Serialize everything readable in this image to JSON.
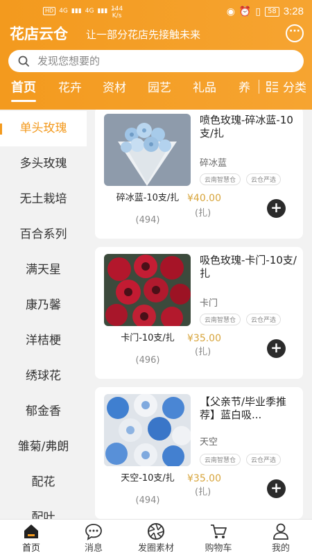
{
  "status_bar": {
    "network_left": "HD",
    "signal1": "4G",
    "signal2": "4G",
    "speed_value": "144",
    "speed_unit": "K/s",
    "battery": "58",
    "time": "3:28"
  },
  "header": {
    "app_title": "花店云仓",
    "slogan": "让一部分花店先接触未来",
    "more_label": "···"
  },
  "search": {
    "placeholder": "发现您想要的"
  },
  "tabs": [
    {
      "label": "首页",
      "active": true
    },
    {
      "label": "花卉"
    },
    {
      "label": "资材"
    },
    {
      "label": "园艺"
    },
    {
      "label": "礼品"
    },
    {
      "label": "养"
    }
  ],
  "category_button": {
    "label": "分类"
  },
  "sidebar": {
    "items": [
      {
        "label": "单头玫瑰",
        "active": true
      },
      {
        "label": "多头玫瑰"
      },
      {
        "label": "无土栽培"
      },
      {
        "label": "百合系列"
      },
      {
        "label": "满天星"
      },
      {
        "label": "康乃馨"
      },
      {
        "label": "洋桔梗"
      },
      {
        "label": "绣球花"
      },
      {
        "label": "郁金香"
      },
      {
        "label": "雏菊/弗朗"
      },
      {
        "label": "配花"
      },
      {
        "label": "配叶"
      }
    ]
  },
  "products": [
    {
      "name": "喷色玫瑰-碎冰蓝-10支/扎",
      "variant": "碎冰蓝",
      "tags": [
        "云南智慧仓",
        "云仓严选"
      ],
      "spec": "碎冰蓝-10支/扎",
      "sales": "(494)",
      "price": "¥40.00",
      "unit": "(扎)"
    },
    {
      "name": "吸色玫瑰-卡门-10支/扎",
      "variant": "卡门",
      "tags": [
        "云南智慧仓",
        "云仓严选"
      ],
      "spec": "卡门-10支/扎",
      "sales": "(496)",
      "price": "¥35.00",
      "unit": "(扎)"
    },
    {
      "name": "【父亲节/毕业季推荐】蓝白吸...",
      "variant": "天空",
      "tags": [
        "云南智慧仓",
        "云仓严选"
      ],
      "spec": "天空-10支/扎",
      "sales": "(494)",
      "price": "¥35.00",
      "unit": "(扎)"
    }
  ],
  "bottom_nav": [
    {
      "label": "首页",
      "icon": "home-icon",
      "active": true
    },
    {
      "label": "消息",
      "icon": "message-icon"
    },
    {
      "label": "发圈素材",
      "icon": "camera-shutter-icon"
    },
    {
      "label": "购物车",
      "icon": "cart-icon"
    },
    {
      "label": "我的",
      "icon": "user-icon"
    }
  ],
  "colors": {
    "brand_orange": "#f39a1e",
    "price_gold": "#d7a43a"
  }
}
